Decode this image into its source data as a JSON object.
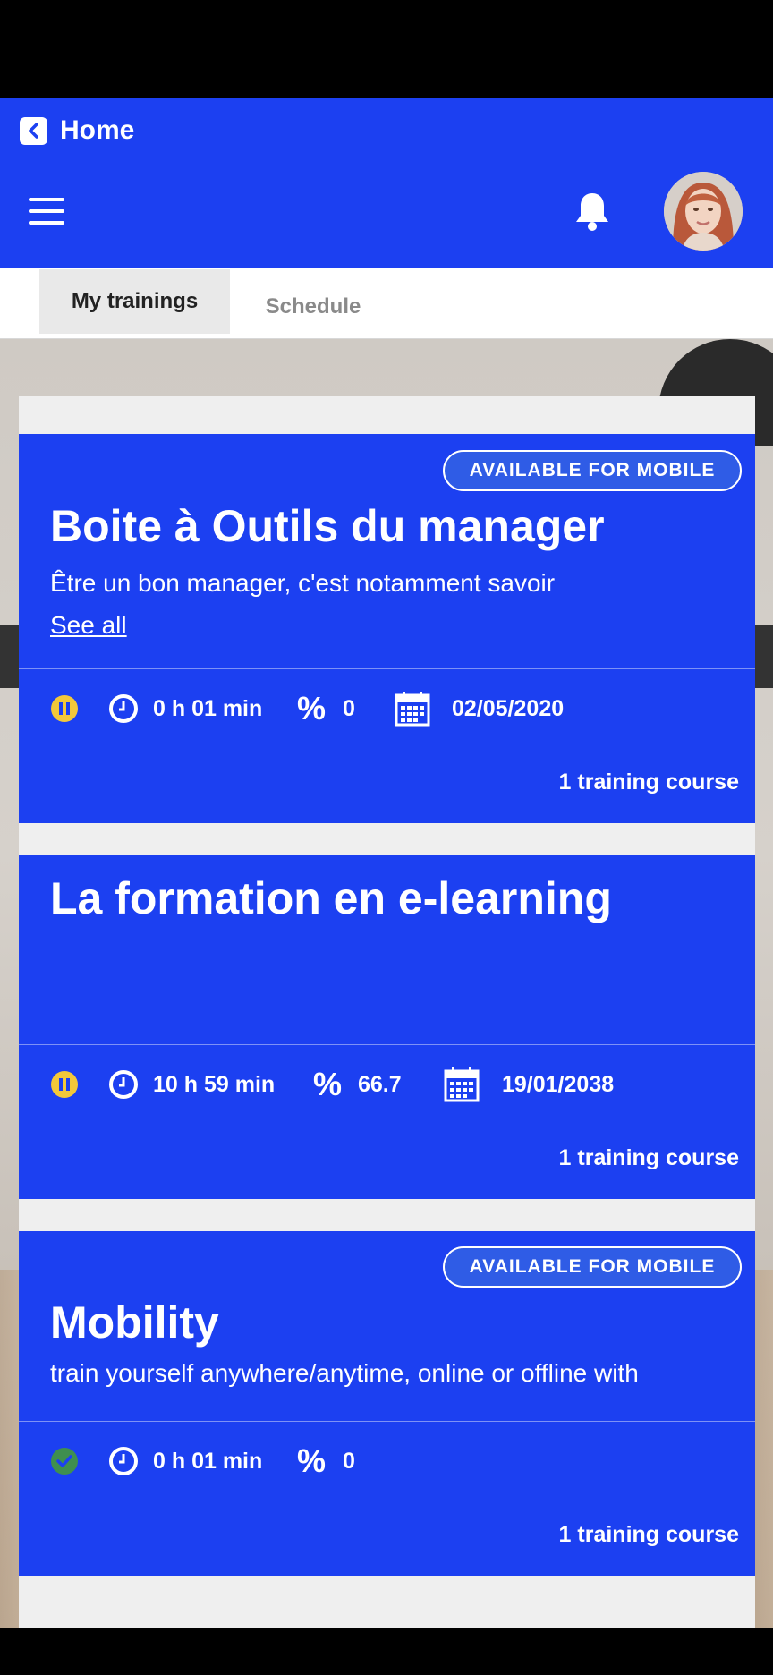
{
  "header": {
    "back_label": "Home"
  },
  "tabs": [
    {
      "label": "My trainings",
      "active": true
    },
    {
      "label": "Schedule",
      "active": false
    }
  ],
  "colors": {
    "brand": "#1c40f1",
    "paused": "#f3c83a",
    "completed": "#3f8f4f"
  },
  "cards": [
    {
      "badge": "AVAILABLE FOR MOBILE",
      "title": "Boite à Outils du manager",
      "description": "Être un bon manager, c'est notamment savoir",
      "link": "See all",
      "status_icon": "pause-icon",
      "duration": "0 h 01 min",
      "progress": "0",
      "date": "02/05/2020",
      "footer": "1 training course"
    },
    {
      "title": "La formation en e-learning",
      "status_icon": "pause-icon",
      "duration": "10 h 59 min",
      "progress": "66.7",
      "date": "19/01/2038",
      "footer": "1 training course"
    },
    {
      "badge": "AVAILABLE FOR MOBILE",
      "title": "Mobility",
      "description": "train yourself anywhere/anytime, online or offline with",
      "status_icon": "check-circle-icon",
      "duration": "0 h 01 min",
      "progress": "0",
      "footer": "1 training course"
    }
  ]
}
